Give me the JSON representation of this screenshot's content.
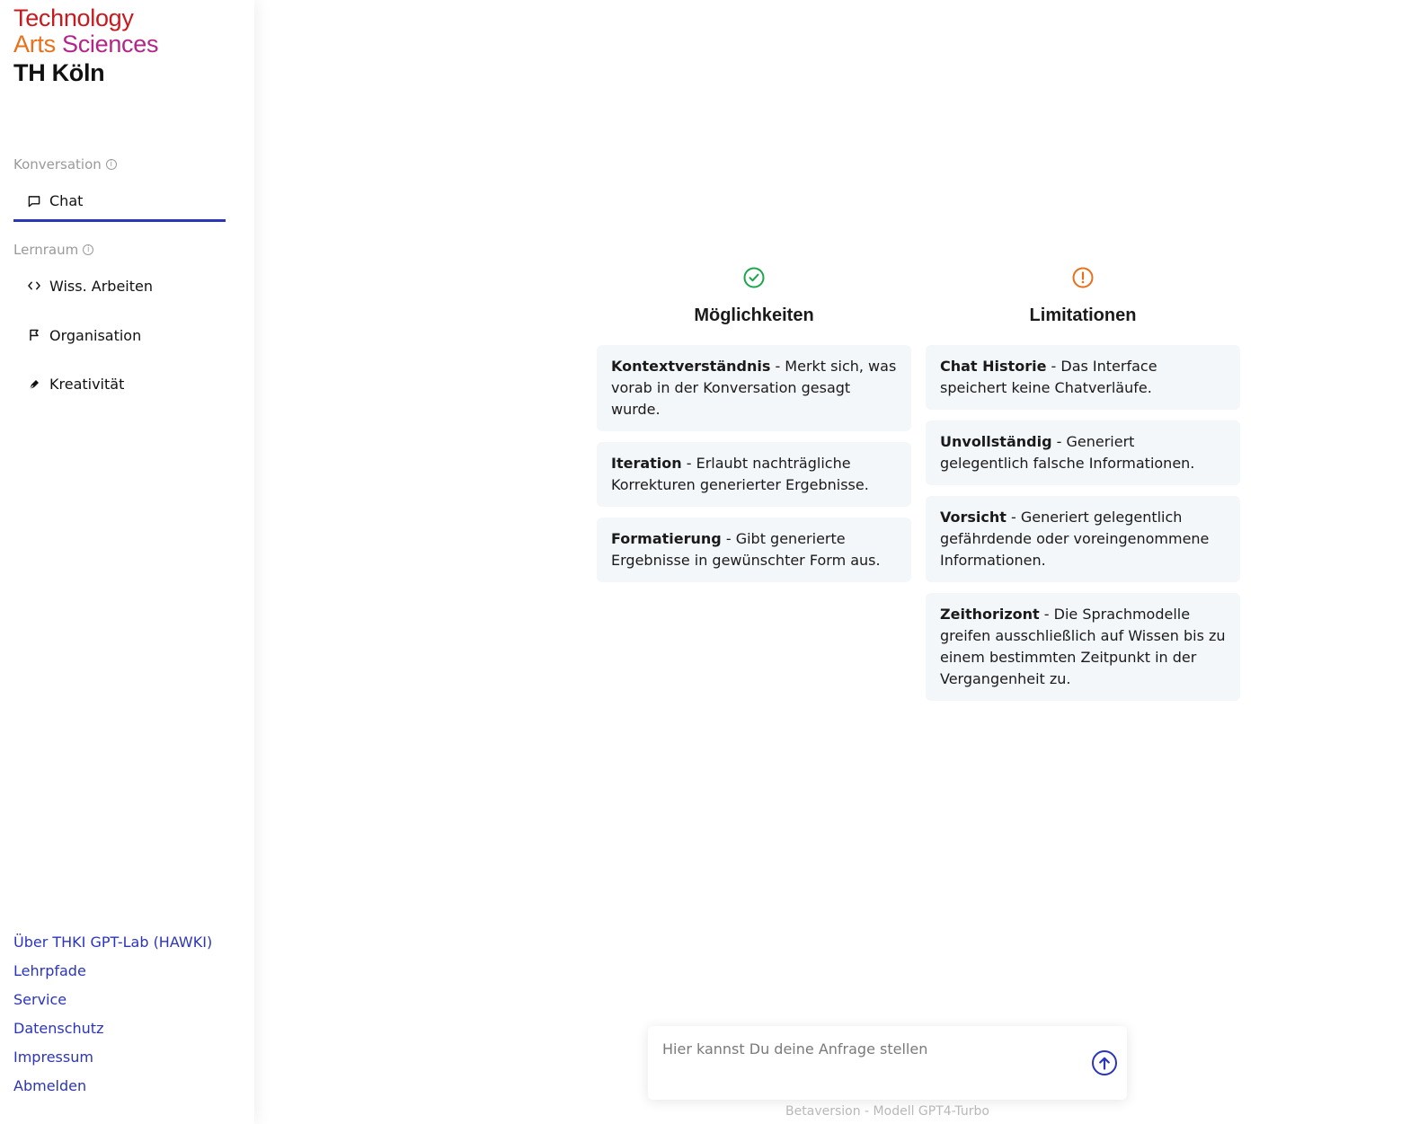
{
  "logo": {
    "line1": "Technology",
    "line2a": "Arts",
    "line2b": "Sciences",
    "line3": "TH Köln"
  },
  "sidebar": {
    "sections": [
      {
        "label": "Konversation",
        "items": [
          {
            "label": "Chat",
            "icon": "chat-bubble-icon",
            "active": true
          }
        ]
      },
      {
        "label": "Lernraum",
        "items": [
          {
            "label": "Wiss. Arbeiten",
            "icon": "code-icon"
          },
          {
            "label": "Organisation",
            "icon": "flag-icon"
          },
          {
            "label": "Kreativität",
            "icon": "pen-nib-icon"
          }
        ]
      }
    ],
    "footer_links": [
      "Über THKI GPT-Lab (HAWKI)",
      "Lehrpfade",
      "Service",
      "Datenschutz",
      "Impressum",
      "Abmelden"
    ]
  },
  "main": {
    "possibilities": {
      "title": "Möglichkeiten",
      "icon": "check-circle-icon",
      "items": [
        {
          "term": "Kontextverständnis",
          "text": " - Merkt sich, was vorab in der Konversation gesagt wurde."
        },
        {
          "term": "Iteration",
          "text": " - Erlaubt nachträgliche Korrekturen generierter Ergebnisse."
        },
        {
          "term": "Formatierung",
          "text": " - Gibt generierte Ergebnisse in gewünschter Form aus."
        }
      ]
    },
    "limitations": {
      "title": "Limitationen",
      "icon": "alert-circle-icon",
      "items": [
        {
          "term": "Chat Historie",
          "text": " - Das Interface speichert keine Chatverläufe."
        },
        {
          "term": "Unvollständig",
          "text": " - Generiert gelegentlich falsche Informationen."
        },
        {
          "term": "Vorsicht",
          "text": " - Generiert gelegentlich gefährdende oder voreingenommene Informationen."
        },
        {
          "term": "Zeithorizont",
          "text": " - Die Sprachmodelle greifen ausschließlich auf Wissen bis zu einem bestimmten Zeitpunkt in der Vergangenheit zu."
        }
      ]
    },
    "input": {
      "placeholder": "Hier kannst Du deine Anfrage stellen",
      "value": ""
    },
    "version": "Betaversion - Modell GPT4-Turbo"
  },
  "colors": {
    "accent": "#2b35b8",
    "check": "#1aa64b",
    "alert": "#e8701a",
    "card_bg": "#f4f7fa"
  }
}
